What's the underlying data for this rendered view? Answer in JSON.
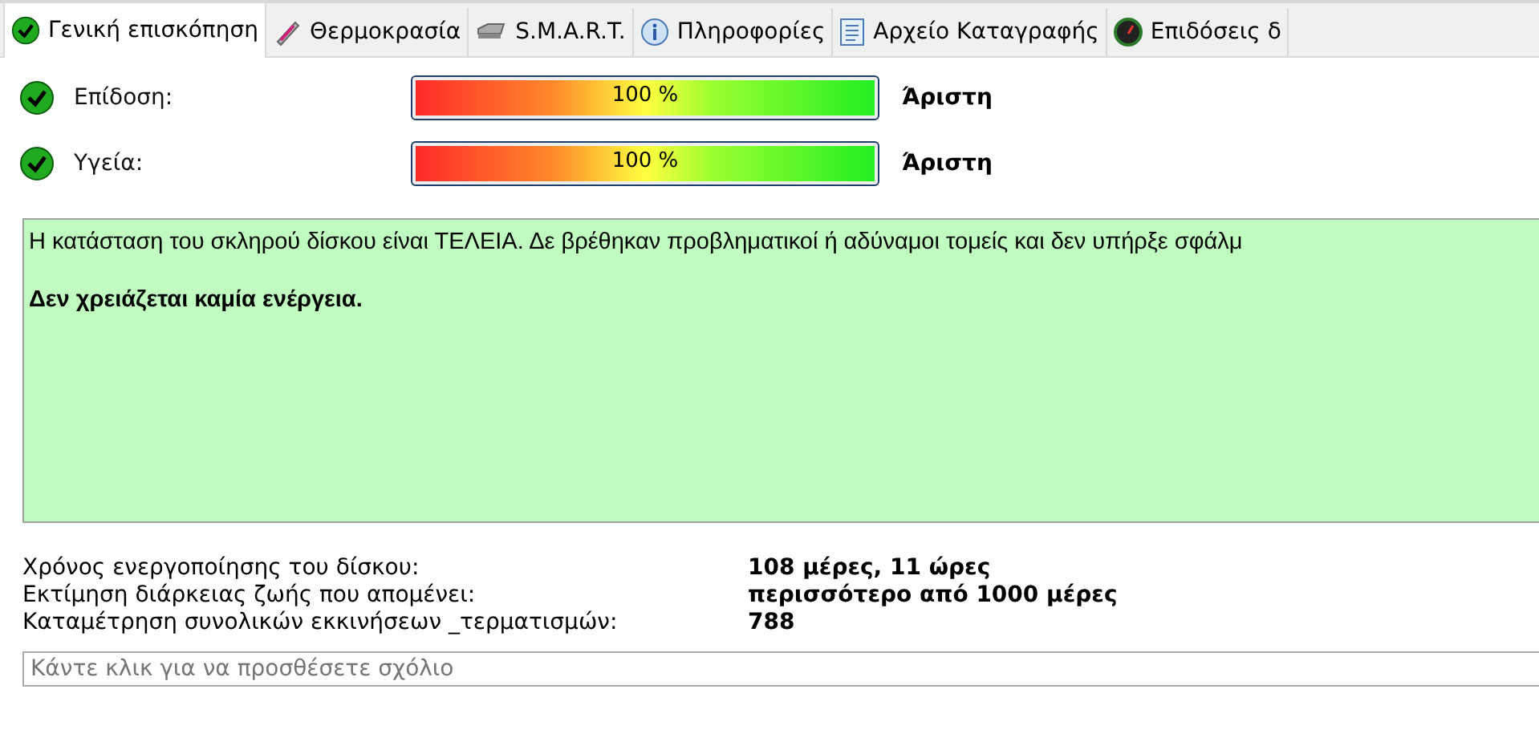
{
  "tabs": [
    {
      "label": "Γενική επισκόπηση",
      "kind": "check",
      "selected": true
    },
    {
      "label": "Θερμοκρασία",
      "kind": "thermo",
      "selected": false
    },
    {
      "label": "S.M.A.R.T.",
      "kind": "drive",
      "selected": false
    },
    {
      "label": "Πληροφορίες",
      "kind": "info",
      "selected": false
    },
    {
      "label": "Αρχείο Καταγραφής",
      "kind": "doc",
      "selected": false
    },
    {
      "label": "Επιδόσεις δ",
      "kind": "gauge",
      "selected": false
    }
  ],
  "meters": [
    {
      "name": "Επίδοση:",
      "level": 1,
      "reading": "100 %",
      "rating": "Άριστη"
    },
    {
      "name": "Υγεία:",
      "level": 1,
      "reading": "100 %",
      "rating": "Άριστη"
    }
  ],
  "status_message": {
    "text": "Η κατάσταση του σκληρού δίσκου είναι ΤΕΛΕΙΑ. Δε βρέθηκαν προβληματικοί ή αδύναμοι τομείς και δεν υπήρξε σφάλμ",
    "action": "Δεν χρειάζεται καμία ενέργεια."
  },
  "details": [
    {
      "label": "Χρόνος ενεργοποίησης του δίσκου:",
      "value": "108 μέρες, 11 ώρες"
    },
    {
      "label": "Εκτίμηση διάρκειας ζωής που απομένει:",
      "value": "περισσότερο από 1000 μέρες"
    },
    {
      "label": "Καταμέτρηση συνολικών εκκινήσεων _τερματισμών:",
      "value": "788"
    }
  ],
  "comment": {
    "placeholder": "Κάντε κλικ για να προσθέσετε σχόλιο"
  }
}
